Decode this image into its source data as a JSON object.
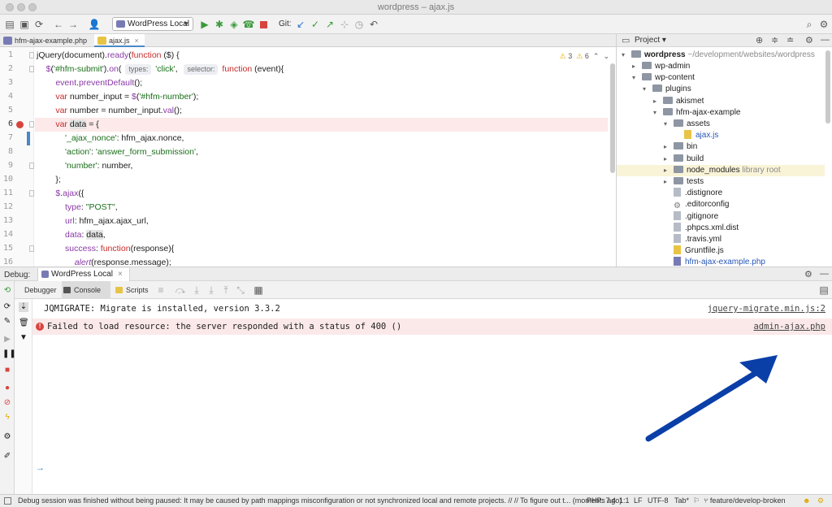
{
  "window": {
    "title": "wordpress – ajax.js"
  },
  "toolbar": {
    "run_config": "WordPress Local",
    "git_label": "Git:"
  },
  "editor_tabs": [
    {
      "label": "hfm-ajax-example.php",
      "type": "php"
    },
    {
      "label": "ajax.js",
      "type": "js",
      "active": true
    }
  ],
  "editor": {
    "inspection": {
      "warnings": "3",
      "weak_warnings": "6"
    },
    "current_line": 6,
    "line_numbers": [
      "1",
      "2",
      "3",
      "4",
      "5",
      "6",
      "7",
      "8",
      "9",
      "10",
      "11",
      "12",
      "13",
      "14",
      "15",
      "16"
    ],
    "hints": {
      "types": "types:",
      "selector": "selector:"
    }
  },
  "project": {
    "title": "Project",
    "root": {
      "name": "wordpress",
      "path": "~/development/websites/wordpress"
    },
    "items": [
      {
        "label": "wp-admin",
        "kind": "folder",
        "depth": 1,
        "arrow": "▸"
      },
      {
        "label": "wp-content",
        "kind": "folder",
        "depth": 1,
        "arrow": "▾"
      },
      {
        "label": "plugins",
        "kind": "folder",
        "depth": 2,
        "arrow": "▾"
      },
      {
        "label": "akismet",
        "kind": "folder",
        "depth": 3,
        "arrow": "▸"
      },
      {
        "label": "hfm-ajax-example",
        "kind": "folder",
        "depth": 3,
        "arrow": "▾"
      },
      {
        "label": "assets",
        "kind": "folder",
        "depth": 4,
        "arrow": "▾"
      },
      {
        "label": "ajax.js",
        "kind": "js",
        "depth": 5,
        "arrow": ""
      },
      {
        "label": "bin",
        "kind": "folder",
        "depth": 4,
        "arrow": "▸"
      },
      {
        "label": "build",
        "kind": "folder",
        "depth": 4,
        "arrow": "▸"
      },
      {
        "label": "node_modules",
        "kind": "folder",
        "depth": 4,
        "arrow": "▸",
        "suffix": "library root",
        "selected": true
      },
      {
        "label": "tests",
        "kind": "folder",
        "depth": 4,
        "arrow": "▸"
      },
      {
        "label": ".distignore",
        "kind": "file",
        "depth": 4,
        "arrow": ""
      },
      {
        "label": ".editorconfig",
        "kind": "gear",
        "depth": 4,
        "arrow": ""
      },
      {
        "label": ".gitignore",
        "kind": "file",
        "depth": 4,
        "arrow": ""
      },
      {
        "label": ".phpcs.xml.dist",
        "kind": "file",
        "depth": 4,
        "arrow": ""
      },
      {
        "label": ".travis.yml",
        "kind": "file",
        "depth": 4,
        "arrow": ""
      },
      {
        "label": "Gruntfile.js",
        "kind": "js",
        "depth": 4,
        "arrow": ""
      },
      {
        "label": "hfm-ajax-example.php",
        "kind": "php",
        "depth": 4,
        "arrow": ""
      }
    ]
  },
  "debug": {
    "label": "Debug:",
    "session_tab": "WordPress Local",
    "subtabs": [
      "Debugger",
      "Console",
      "Scripts"
    ],
    "active_subtab": "Console",
    "console_lines": [
      {
        "level": "info",
        "message": "JQMIGRATE: Migrate is installed, version 3.3.2",
        "source": "jquery-migrate.min.js:2"
      },
      {
        "level": "error",
        "message": "Failed to load resource: the server responded with a status of 400 ()",
        "source": "admin-ajax.php"
      }
    ],
    "prompt": "→",
    "annotation_color": "#0a3fa8"
  },
  "statusbar": {
    "message": "Debug session was finished without being paused: It may be caused by path mappings misconfiguration or not synchronized local and remote projects. // // To figure out t... (moments ago)",
    "php_version": "PHP: 7.4",
    "position": "1:1",
    "line_sep": "LF",
    "encoding": "UTF-8",
    "indent": "Tab*",
    "branch": "feature/develop-broken"
  }
}
